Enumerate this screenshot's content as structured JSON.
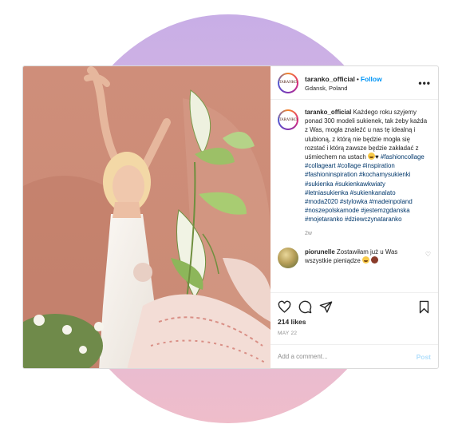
{
  "post": {
    "username": "taranko_official",
    "follow_label": "Follow",
    "location": "Gdansk, Poland",
    "more_label": "•••",
    "avatar_text": "TARANKO",
    "caption": {
      "username": "taranko_official",
      "text": "Każdego roku szyjemy ponad 300 modeli sukienek, tak żeby każda z Was, mogła znaleźć u nas tę idealną i ulubioną, z którą nie będzie mogła się rozstać i którą zawsze będzie zakładać z uśmiechem na ustach",
      "hashtags": [
        "#fashioncollage",
        "#collageart",
        "#collage",
        "#inspiration",
        "#fashioninspiration",
        "#kochamysukienki",
        "#sukienka",
        "#sukienkawkwiaty",
        "#letniasukienka",
        "#sukienkanalato",
        "#moda2020",
        "#stylowka",
        "#madeinpoland",
        "#noszepolskamode",
        "#jestemzgdanska",
        "#mojetaranko",
        "#dziewczynataranko"
      ],
      "time": "2w"
    },
    "reply": {
      "username": "piorunelle",
      "text": "Zostawiłam już u Was wszystkie pieniądze"
    },
    "likes": "214 likes",
    "date": "MAY 22",
    "comment_placeholder": "Add a comment...",
    "post_label": "Post"
  },
  "icons": [
    "heart-icon",
    "comment-icon",
    "share-icon",
    "bookmark-icon"
  ],
  "colors": {
    "follow": "#0095f6",
    "hashtag": "#00376b",
    "muted": "#8e8e8e",
    "post_disabled": "#b2dffc"
  }
}
